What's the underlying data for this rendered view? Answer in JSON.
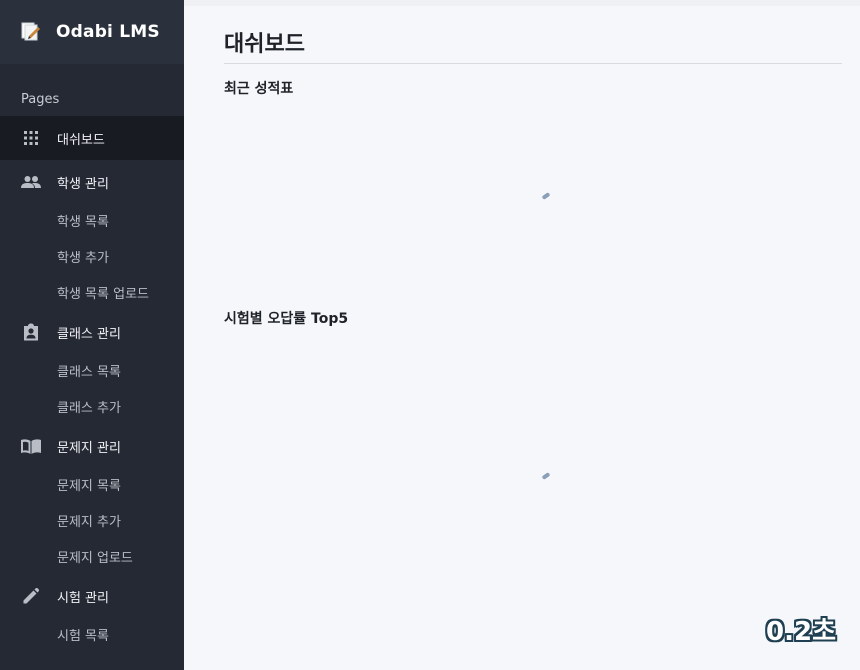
{
  "app": {
    "title": "Odabi LMS"
  },
  "sidebar": {
    "section_label": "Pages",
    "items": [
      {
        "label": "대쉬보드",
        "icon": "grid-icon",
        "active": true
      },
      {
        "label": "학생 관리",
        "icon": "people-icon"
      },
      {
        "label": "학생 목록"
      },
      {
        "label": "학생 추가"
      },
      {
        "label": "학생 목록 업로드"
      },
      {
        "label": "클래스 관리",
        "icon": "clipboard-account-icon"
      },
      {
        "label": "클래스 목록"
      },
      {
        "label": "클래스 추가"
      },
      {
        "label": "문제지 관리",
        "icon": "book-icon"
      },
      {
        "label": "문제지 목록"
      },
      {
        "label": "문제지 추가"
      },
      {
        "label": "문제지 업로드"
      },
      {
        "label": "시험 관리",
        "icon": "pencil-icon"
      },
      {
        "label": "시험 목록"
      }
    ]
  },
  "main": {
    "page_title": "대쉬보드",
    "sections": [
      {
        "title": "최근 성적표"
      },
      {
        "title": "시험별 오답률 Top5"
      }
    ]
  },
  "overlay": {
    "badge": "0.2초"
  },
  "colors": {
    "sidebar_bg": "#242933",
    "brand_bg": "#2b313c",
    "active_bg": "#181c22",
    "main_bg": "#f6f7fa"
  }
}
